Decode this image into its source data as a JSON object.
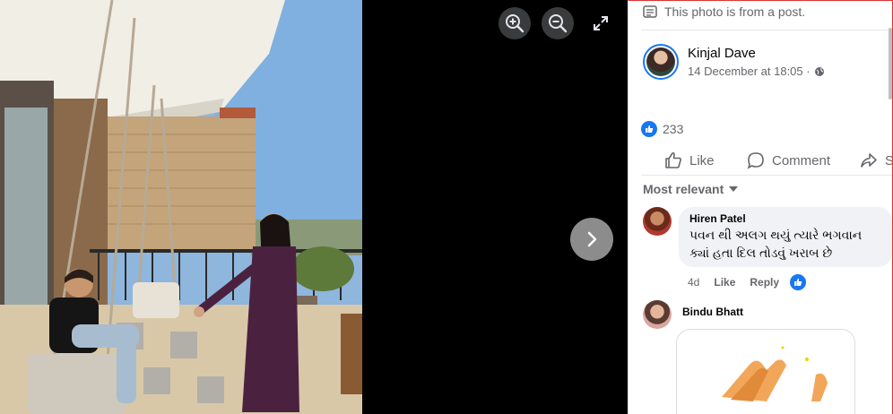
{
  "viewer": {
    "icons": {
      "zoom_in": "zoom-in-icon",
      "zoom_out": "zoom-out-icon",
      "fullscreen": "fullscreen-icon",
      "next": "chevron-right-icon"
    }
  },
  "post_note": {
    "text": "This photo is from a post.",
    "icon": "document-icon"
  },
  "author": {
    "name": "Kinjal Dave",
    "timestamp": "14 December at 18:05 ·",
    "privacy_icon": "globe-icon"
  },
  "reactions": {
    "count": "233",
    "icon": "like-icon"
  },
  "actions": {
    "like": "Like",
    "comment": "Comment",
    "share": "S"
  },
  "sort": {
    "label": "Most relevant"
  },
  "comments": [
    {
      "name": "Hiren Patel",
      "text": "પવન થી અલગ થયું ત્યારે ભગવાન ક્યાં હતા દિલ તોડવું ખરાબ છે",
      "age": "4d",
      "like": "Like",
      "reply": "Reply"
    },
    {
      "name": "Bindu Bhatt"
    }
  ],
  "colors": {
    "accent": "#1877f2",
    "secondary_text": "#65676b",
    "bubble": "#f0f2f5"
  }
}
